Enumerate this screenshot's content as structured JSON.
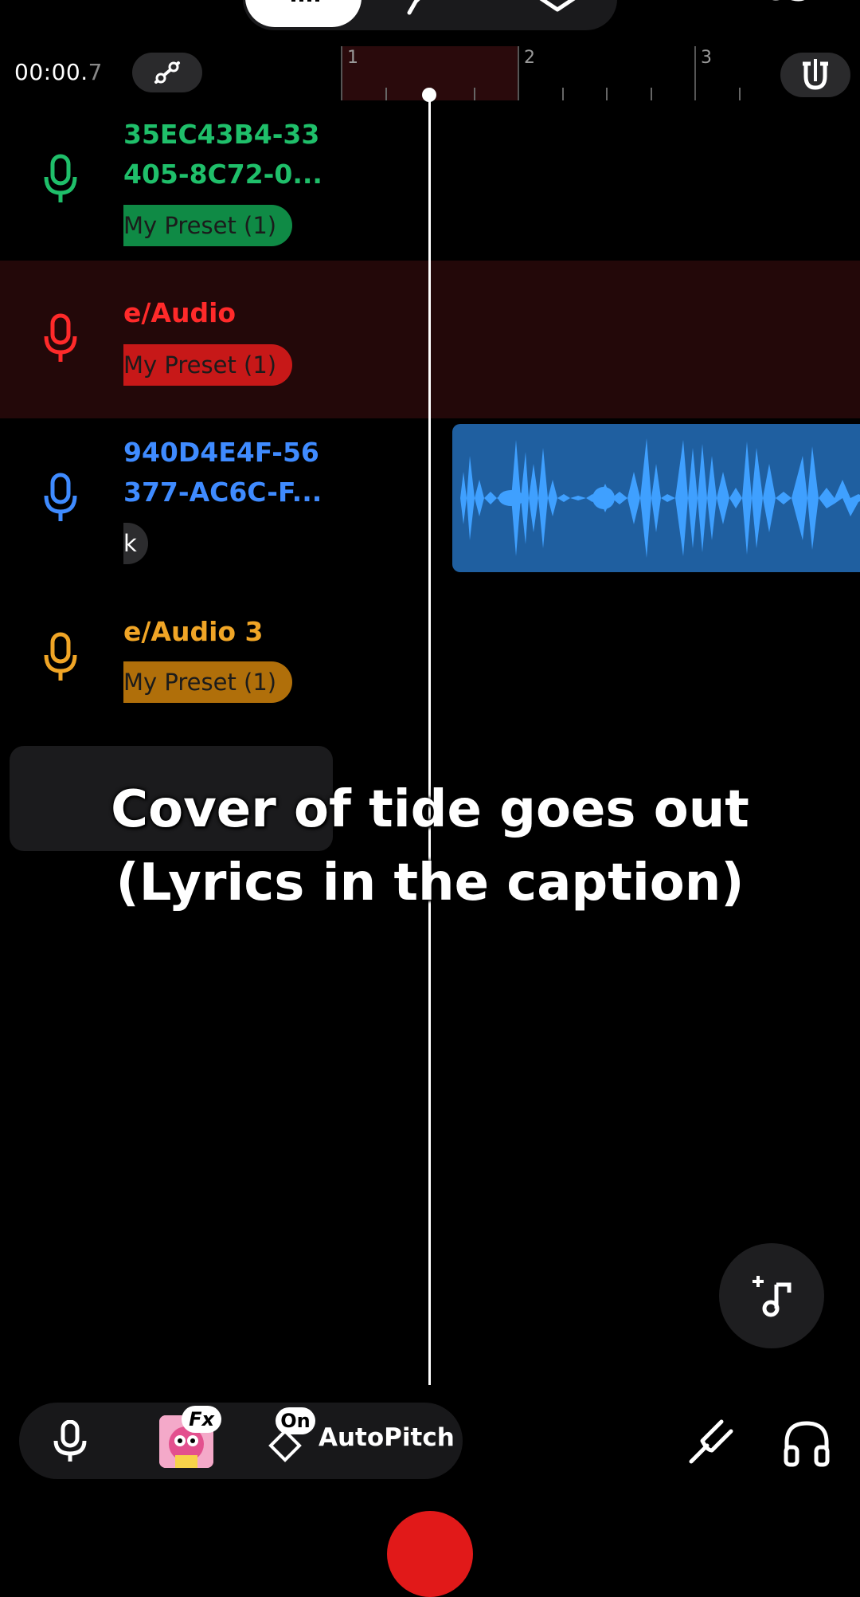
{
  "header": {
    "time_main": "00:00.",
    "time_frac": "7"
  },
  "ruler": {
    "labels": [
      "1",
      "2",
      "3"
    ]
  },
  "tracks": [
    {
      "title": "35EC43B4-33\n405-8C72-0...",
      "preset": "My Preset (1)",
      "color": "#1fbf6a",
      "preset_color": "#0f8a45"
    },
    {
      "title": "e/Audio",
      "preset": "My Preset (1)",
      "color": "#ff2a2a",
      "preset_color": "#c71818"
    },
    {
      "title": "940D4E4F-56\n377-AC6C-F...",
      "preset": "k",
      "color": "#3f8bff",
      "preset_color": "#2c2c2e"
    },
    {
      "title": "e/Audio 3",
      "preset": "My Preset (1)",
      "color": "#f0a526",
      "preset_color": "#b06f0a"
    }
  ],
  "caption": {
    "line1": "Cover of tide goes out",
    "line2": "(Lyrics in the caption)"
  },
  "bottom_bar": {
    "fx_badge": "Fx",
    "on_badge": "On",
    "autopitch_label": "AutoPitch"
  },
  "icons": [
    "mic-icon",
    "automation-icon",
    "magnet-icon",
    "add-track-icon",
    "tuning-fork-icon",
    "headphones-icon"
  ]
}
